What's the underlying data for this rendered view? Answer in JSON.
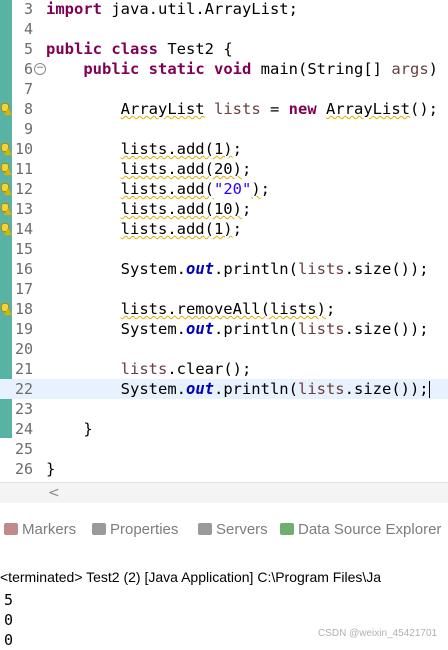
{
  "editor": {
    "lines": [
      {
        "num": "3",
        "tokens": [
          {
            "t": "import",
            "c": "kw"
          },
          {
            "t": " java.util.ArrayList;"
          }
        ]
      },
      {
        "num": "4",
        "tokens": []
      },
      {
        "num": "5",
        "tokens": [
          {
            "t": "public",
            "c": "kw"
          },
          {
            "t": " "
          },
          {
            "t": "class",
            "c": "kw"
          },
          {
            "t": " Test2 {"
          }
        ]
      },
      {
        "num": "6",
        "fold": "collapse-marker",
        "tokens": [
          {
            "t": "    "
          },
          {
            "t": "public",
            "c": "kw"
          },
          {
            "t": " "
          },
          {
            "t": "static",
            "c": "kw"
          },
          {
            "t": " "
          },
          {
            "t": "void",
            "c": "kw"
          },
          {
            "t": " main(String[] "
          },
          {
            "t": "args",
            "c": "var"
          },
          {
            "t": ") {"
          }
        ]
      },
      {
        "num": "7",
        "tokens": []
      },
      {
        "num": "8",
        "warn": true,
        "tokens": [
          {
            "t": "        "
          },
          {
            "t": "ArrayList",
            "c": "wavy"
          },
          {
            "t": " "
          },
          {
            "t": "lists",
            "c": "var"
          },
          {
            "t": " = "
          },
          {
            "t": "new",
            "c": "kw"
          },
          {
            "t": " "
          },
          {
            "t": "ArrayList",
            "c": "wavy"
          },
          {
            "t": "();"
          }
        ]
      },
      {
        "num": "9",
        "tokens": []
      },
      {
        "num": "10",
        "warn": true,
        "tokens": [
          {
            "t": "        "
          },
          {
            "t": "lists.add(1)",
            "c": "wavy"
          },
          {
            "t": ";"
          }
        ]
      },
      {
        "num": "11",
        "warn": true,
        "tokens": [
          {
            "t": "        "
          },
          {
            "t": "lists.add(20)",
            "c": "wavy"
          },
          {
            "t": ";"
          }
        ]
      },
      {
        "num": "12",
        "warn": true,
        "tokens": [
          {
            "t": "        "
          },
          {
            "t": "lists.add(",
            "c": "wavy"
          },
          {
            "t": "\"20\"",
            "c": "str"
          },
          {
            "t": ")",
            "c": "wavy"
          },
          {
            "t": ";"
          }
        ]
      },
      {
        "num": "13",
        "warn": true,
        "tokens": [
          {
            "t": "        "
          },
          {
            "t": "lists.add(10)",
            "c": "wavy"
          },
          {
            "t": ";"
          }
        ]
      },
      {
        "num": "14",
        "warn": true,
        "tokens": [
          {
            "t": "        "
          },
          {
            "t": "lists.add(1)",
            "c": "wavy"
          },
          {
            "t": ";"
          }
        ]
      },
      {
        "num": "15",
        "tokens": []
      },
      {
        "num": "16",
        "tokens": [
          {
            "t": "        System."
          },
          {
            "t": "out",
            "c": "fld"
          },
          {
            "t": ".println("
          },
          {
            "t": "lists",
            "c": "var"
          },
          {
            "t": ".size());"
          }
        ]
      },
      {
        "num": "17",
        "tokens": []
      },
      {
        "num": "18",
        "warn": true,
        "tokens": [
          {
            "t": "        "
          },
          {
            "t": "lists.removeAll(lists)",
            "c": "wavy"
          },
          {
            "t": ";"
          }
        ]
      },
      {
        "num": "19",
        "tokens": [
          {
            "t": "        System."
          },
          {
            "t": "out",
            "c": "fld"
          },
          {
            "t": ".println("
          },
          {
            "t": "lists",
            "c": "var"
          },
          {
            "t": ".size());"
          }
        ]
      },
      {
        "num": "20",
        "tokens": []
      },
      {
        "num": "21",
        "tokens": [
          {
            "t": "        "
          },
          {
            "t": "lists",
            "c": "var"
          },
          {
            "t": ".clear();"
          }
        ]
      },
      {
        "num": "22",
        "current": true,
        "caret": true,
        "tokens": [
          {
            "t": "        System."
          },
          {
            "t": "out",
            "c": "fld"
          },
          {
            "t": ".println("
          },
          {
            "t": "lists",
            "c": "var"
          },
          {
            "t": ".size());"
          }
        ]
      },
      {
        "num": "23",
        "tokens": []
      },
      {
        "num": "24",
        "tokens": [
          {
            "t": "    }"
          }
        ]
      },
      {
        "num": "25",
        "tokens": []
      },
      {
        "num": "26",
        "tokens": [
          {
            "t": "}"
          }
        ]
      }
    ]
  },
  "tabs": [
    {
      "label": "Markers",
      "icon": "markers-icon",
      "color": "#c08a8a"
    },
    {
      "label": "Properties",
      "icon": "properties-icon",
      "color": "#9a9a9a"
    },
    {
      "label": "Servers",
      "icon": "servers-icon",
      "color": "#9a9a9a"
    },
    {
      "label": "Data Source Explorer",
      "icon": "data-source-icon",
      "color": "#6fae6f"
    }
  ],
  "console": {
    "header": "<terminated> Test2 (2) [Java Application] C:\\Program Files\\Ja",
    "output": [
      "5",
      "0",
      "0"
    ]
  },
  "watermark": "CSDN @weixin_45421701",
  "scroll_arrow": "<"
}
